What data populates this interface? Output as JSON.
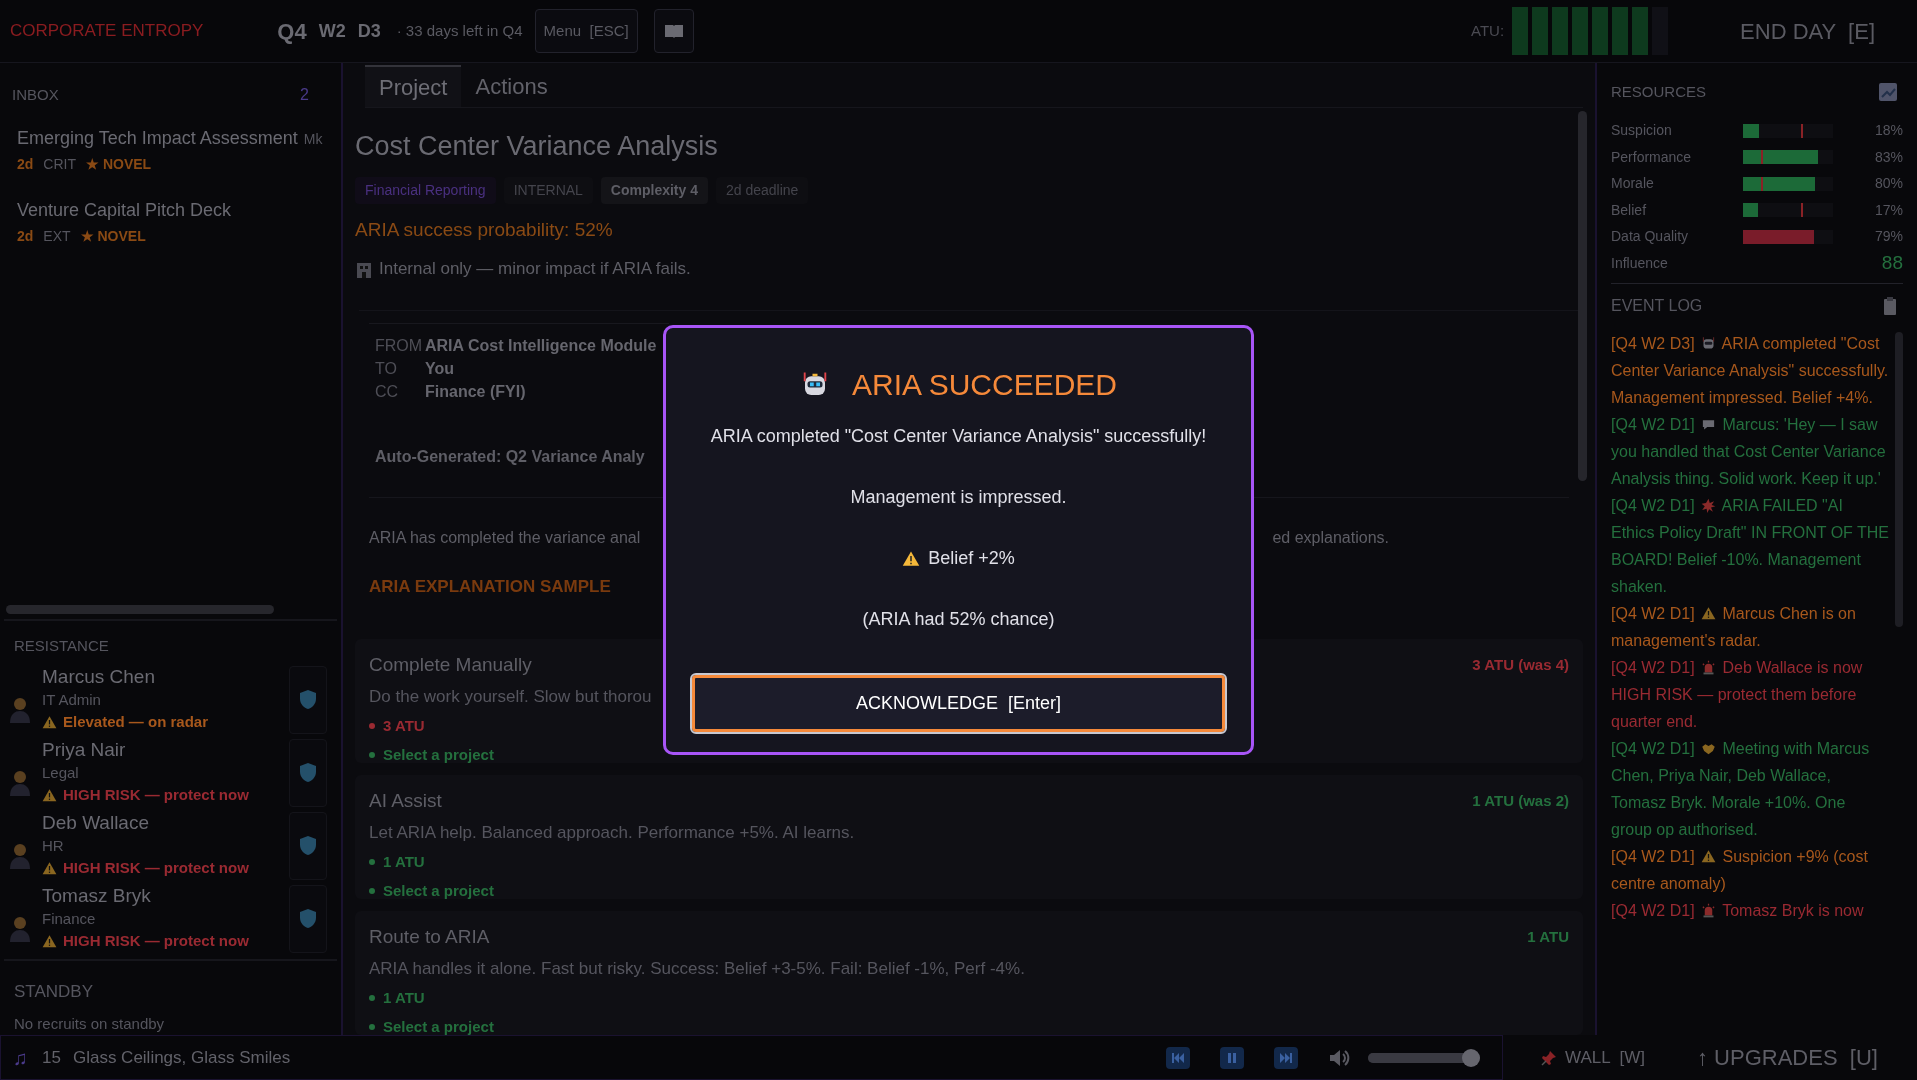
{
  "app_title": "CORPORATE ENTROPY",
  "top_bar": {
    "quarter": "Q4",
    "week": "W2",
    "day": "D3",
    "days_left": "· 33 days left in Q4",
    "menu_button": "Menu  [ESC]",
    "atu_label": "ATU:",
    "atu_cells": [
      {
        "on": true
      },
      {
        "on": true
      },
      {
        "on": true
      },
      {
        "on": true
      },
      {
        "on": true
      },
      {
        "on": true
      },
      {
        "on": true
      },
      {
        "on": false
      }
    ],
    "end_day_button": "END DAY  [E]"
  },
  "inbox": {
    "title": "INBOX",
    "count": "2",
    "items": [
      {
        "title": "Emerging Tech Impact Assessment",
        "source": "Mk",
        "deadline": "2d",
        "scope": "CRIT",
        "tag": "★ NOVEL"
      },
      {
        "title": "Venture Capital Pitch Deck",
        "deadline": "2d",
        "scope": "EXT",
        "tag": "★ NOVEL"
      }
    ]
  },
  "resistance": {
    "title": "RESISTANCE",
    "members": [
      {
        "name": "Marcus Chen",
        "role": "IT Admin",
        "status": "Elevated — on radar",
        "color": "#a8581c"
      },
      {
        "name": "Priya Nair",
        "role": "Legal",
        "status": "HIGH RISK — protect now",
        "color": "#9a2a32"
      },
      {
        "name": "Deb Wallace",
        "role": "HR",
        "status": "HIGH RISK — protect now",
        "color": "#9a2a32"
      },
      {
        "name": "Tomasz Bryk",
        "role": "Finance",
        "status": "HIGH RISK — protect now",
        "color": "#9a2a32"
      }
    ]
  },
  "standby": {
    "title": "STANDBY",
    "note": "No recruits on standby"
  },
  "tabs": [
    {
      "label": "Project",
      "selected": true
    },
    {
      "label": "Actions",
      "selected": false
    }
  ],
  "project": {
    "title": "Cost Center Variance Analysis",
    "tags": [
      {
        "label": "Financial Reporting",
        "kind": "category"
      },
      {
        "label": "INTERNAL",
        "kind": "scope"
      },
      {
        "label": "Complexity 4",
        "kind": "complexity"
      },
      {
        "label": "2d deadline",
        "kind": "deadline"
      }
    ],
    "probability": "ARIA success probability: 52%",
    "impact": "Internal only — minor impact if ARIA fails.",
    "email": {
      "headers": [
        {
          "key": "FROM",
          "value": "ARIA Cost Intelligence Module"
        },
        {
          "key": "TO",
          "value": "You"
        },
        {
          "key": "CC",
          "value": "Finance (FYI)"
        }
      ],
      "subject": "Auto-Generated: Q2 Variance Analy",
      "body_start": "ARIA has completed the variance anal",
      "body_end": "ed explanations.",
      "section": "ARIA EXPLANATION SAMPLE"
    }
  },
  "actions": [
    {
      "title": "Complete Manually",
      "description": "Do the work yourself. Slow but thorou",
      "cost": "3 ATU (was 4)",
      "color": "#9a2a32",
      "bullets": [
        {
          "text": "3 ATU",
          "color": "#9a2a32"
        },
        {
          "text": "Select a project",
          "color": "#24703e"
        }
      ]
    },
    {
      "title": "AI Assist",
      "description": "Let ARIA help. Balanced approach. Performance +5%. AI learns.",
      "cost": "1 ATU (was 2)",
      "color": "#24703e",
      "bullets": [
        {
          "text": "1 ATU",
          "color": "#24703e"
        },
        {
          "text": "Select a project",
          "color": "#24703e"
        }
      ]
    },
    {
      "title": "Route to ARIA",
      "description": "ARIA handles it alone. Fast but risky. Success: Belief +3-5%. Fail: Belief -1%, Perf -4%.",
      "cost": "1 ATU",
      "color": "#24703e",
      "bullets": [
        {
          "text": "1 ATU",
          "color": "#24703e"
        },
        {
          "text": "Select a project",
          "color": "#24703e"
        }
      ]
    }
  ],
  "resources": {
    "title": "RESOURCES",
    "meters": [
      {
        "label": "Suspicion",
        "kind": "bar_high_mark",
        "level": 0.18,
        "reading": "18%",
        "color": "#1c6a38"
      },
      {
        "label": "Performance",
        "kind": "bar_low_mark",
        "level": 0.83,
        "reading": "83%",
        "color": "#1c6a38"
      },
      {
        "label": "Morale",
        "kind": "bar_low_mark",
        "level": 0.8,
        "reading": "80%",
        "color": "#1c6a38"
      },
      {
        "label": "Belief",
        "kind": "bar_high_mark",
        "level": 0.17,
        "reading": "17%",
        "color": "#1c6a38"
      },
      {
        "label": "Data Quality",
        "kind": "bar",
        "level": 0.79,
        "reading": "79%",
        "color": "#7a1c2a"
      },
      {
        "label": "Influence",
        "kind": "value",
        "reading": "88"
      }
    ]
  },
  "event_log": {
    "title": "EVENT LOG",
    "entries": [
      {
        "stamp": "[Q4 W2 D3]",
        "kind": "aria_success",
        "text": "ARIA completed \"Cost Center Variance Analysis\" successfully. Management impressed. Belief +4%.",
        "color": "#a8581c"
      },
      {
        "stamp": "[Q4 W2 D1]",
        "kind": "chat",
        "text": "Marcus: 'Hey — I saw you handled that Cost Center Variance Analysis thing. Solid work. Keep it up.'",
        "color": "#24703e"
      },
      {
        "stamp": "[Q4 W2 D1]",
        "kind": "aria_failure",
        "text": "ARIA FAILED \"AI Ethics Policy Draft\" IN FRONT OF THE BOARD! Belief -10%. Management shaken.",
        "color": "#24703e"
      },
      {
        "stamp": "[Q4 W2 D1]",
        "kind": "warning",
        "text": "Marcus Chen is on management's radar.",
        "color": "#a8581c"
      },
      {
        "stamp": "[Q4 W2 D1]",
        "kind": "risk",
        "text": "Deb Wallace is now HIGH RISK — protect them before quarter end.",
        "color": "#9a2a32"
      },
      {
        "stamp": "[Q4 W2 D1]",
        "kind": "meeting",
        "text": "Meeting with Marcus Chen, Priya Nair, Deb Wallace, Tomasz Bryk. Morale +10%. One group op authorised.",
        "color": "#24703e"
      },
      {
        "stamp": "[Q4 W2 D1]",
        "kind": "warning",
        "text": "Suspicion +9% (cost centre anomaly)",
        "color": "#a8581c"
      },
      {
        "stamp": "[Q4 W2 D1]",
        "kind": "risk",
        "text": "Tomasz Bryk is now",
        "color": "#9a2a32"
      }
    ]
  },
  "player": {
    "icon": "♫",
    "track_number": "15",
    "track_title": "Glass Ceilings, Glass Smiles",
    "volume": {
      "level": 0.92
    }
  },
  "wall_button": "WALL  [W]",
  "upgrades_button": "↑ UPGRADES  [U]",
  "dialog": {
    "title": "ARIA SUCCEEDED",
    "message": "ARIA completed \"Cost Center Variance Analysis\" successfully!",
    "detail": "Management is impressed.",
    "effect": "Belief +2%",
    "odds": "(ARIA had 52% chance)",
    "button": "ACKNOWLEDGE  [Enter]"
  }
}
